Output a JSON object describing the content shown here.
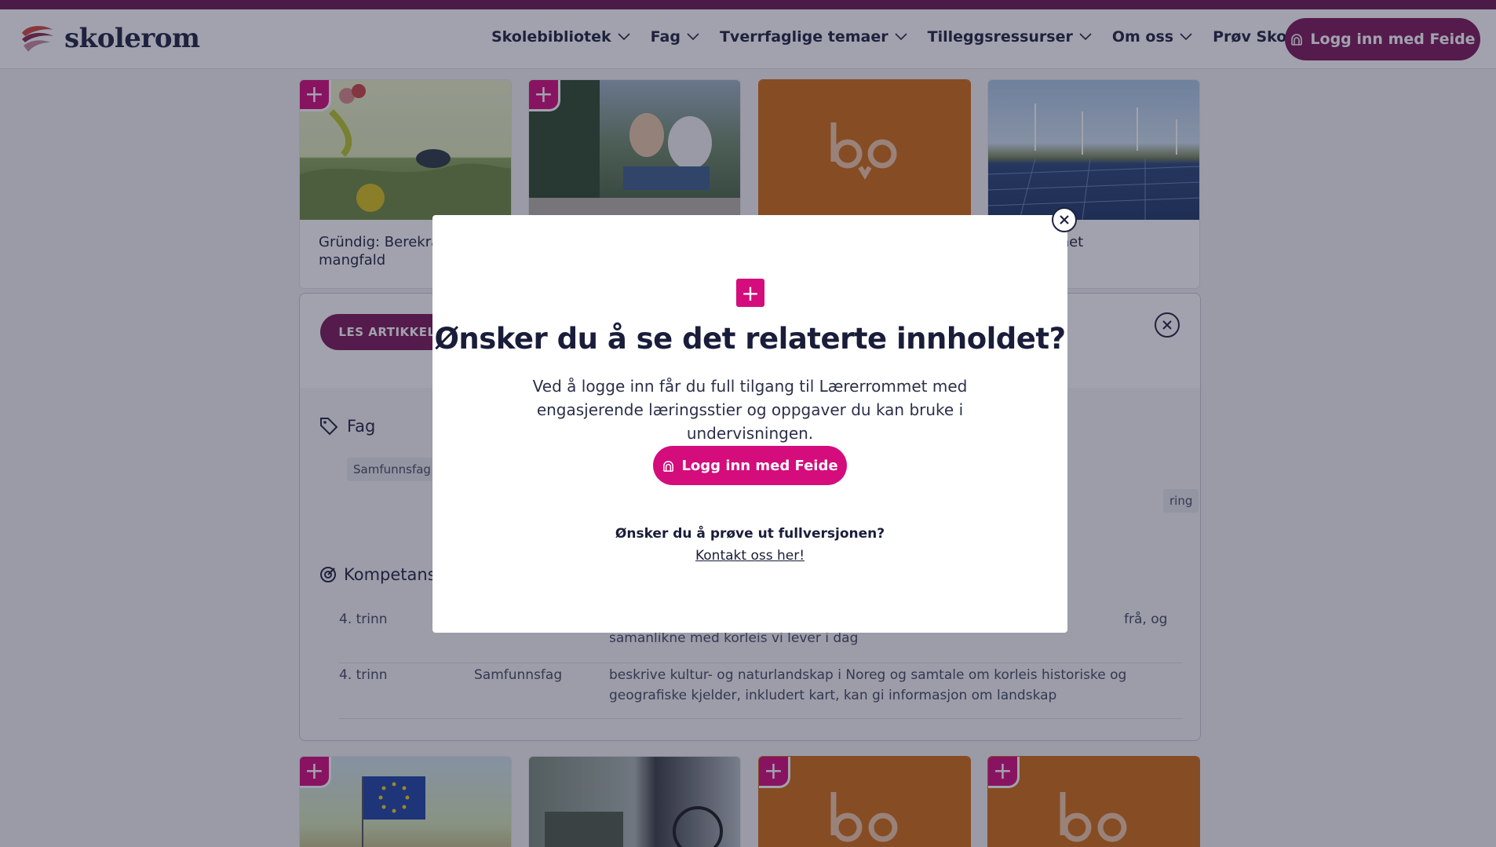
{
  "app": {
    "logo_text": "skolerom"
  },
  "nav": {
    "items": [
      {
        "label": "Skolebibliotek"
      },
      {
        "label": "Fag"
      },
      {
        "label": "Tverrfaglige temaer"
      },
      {
        "label": "Tilleggsressurser"
      },
      {
        "label": "Om oss"
      },
      {
        "label": "Prøv Skolerom"
      }
    ],
    "login_label": "Logg inn med Feide"
  },
  "cards_top": [
    {
      "caption": "Gründig: Berekraft mangfald"
    },
    {
      "caption": ""
    },
    {
      "caption": ""
    },
    {
      "caption": "oon monet"
    }
  ],
  "panel": {
    "read_button": "LES ARTIKKEL",
    "fag_heading": "Fag",
    "fag_tags": [
      "Samfunnsfag",
      "ring"
    ],
    "komp_heading": "Kompetanse",
    "rows": [
      {
        "trinn": "4. trinn",
        "fag": "",
        "text_right": "frå, og",
        "text_cont": "samanlikne med korleis vi lever i dag"
      },
      {
        "trinn": "4. trinn",
        "fag": "Samfunnsfag",
        "text": "beskrive kultur- og naturlandskap i Noreg og samtale om korleis historiske og geografiske kjelder, inkludert kart, kan gi informasjon om landskap"
      }
    ]
  },
  "modal": {
    "title": "Ønsker du å se det relaterte innholdet?",
    "text": "Ved å logge inn får du full tilgang til Lærerrommet med engasjerende læringsstier og oppgaver du kan bruke i undervisningen.",
    "login_label": "Logg inn med Feide",
    "question": "Ønsker du å prøve ut fullversjonen?",
    "contact_link": "Kontakt oss her!"
  },
  "colors": {
    "accent": "#d40c7c",
    "brand_dark": "#7a1859",
    "card_orange": "#d16c12"
  }
}
